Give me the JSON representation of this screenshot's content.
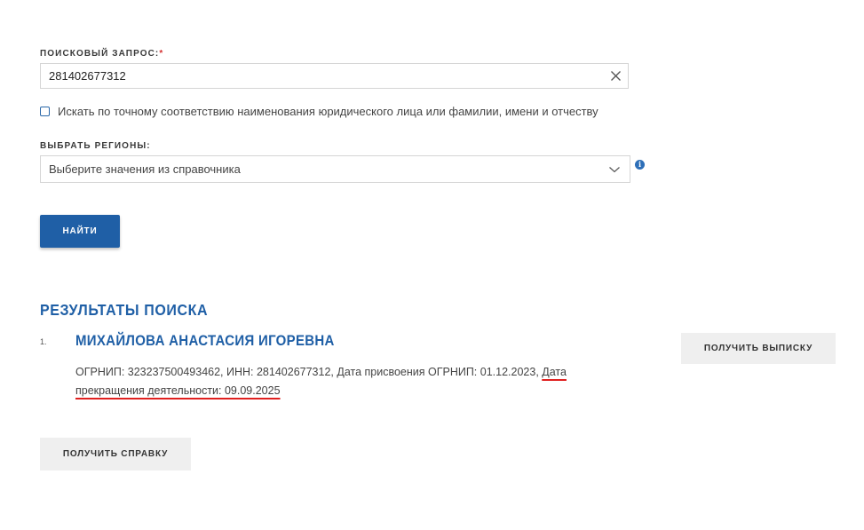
{
  "search": {
    "label": "ПОИСКОВЫЙ ЗАПРОС:",
    "required_mark": "*",
    "value": "281402677312",
    "clear_icon": "close-icon"
  },
  "exact_match": {
    "checked": false,
    "label": "Искать по точному соответствию наименования юридического лица или фамилии, имени и отчеству"
  },
  "regions": {
    "label": "ВЫБРАТЬ РЕГИОНЫ:",
    "placeholder": "Выберите значения из справочника",
    "info_glyph": "i"
  },
  "find_button": {
    "label": "НАЙТИ"
  },
  "results": {
    "title": "РЕЗУЛЬТАТЫ ПОИСКА",
    "items": [
      {
        "index": "1.",
        "name": "МИХАЙЛОВА АНАСТАСИЯ ИГОРЕВНА",
        "details_main": "ОГРНИП: 323237500493462, ИНН: 281402677312, Дата присвоения ОГРНИП: 01.12.2023, ",
        "details_highlight": "Дата прекращения деятельности: 09.09.2025",
        "extract_button": "ПОЛУЧИТЬ ВЫПИСКУ"
      }
    ]
  },
  "certificate_button": {
    "label": "ПОЛУЧИТЬ СПРАВКУ"
  },
  "colors": {
    "accent": "#1f5fa6",
    "required": "#d32f2f",
    "highlight_underline": "#e0201f"
  }
}
